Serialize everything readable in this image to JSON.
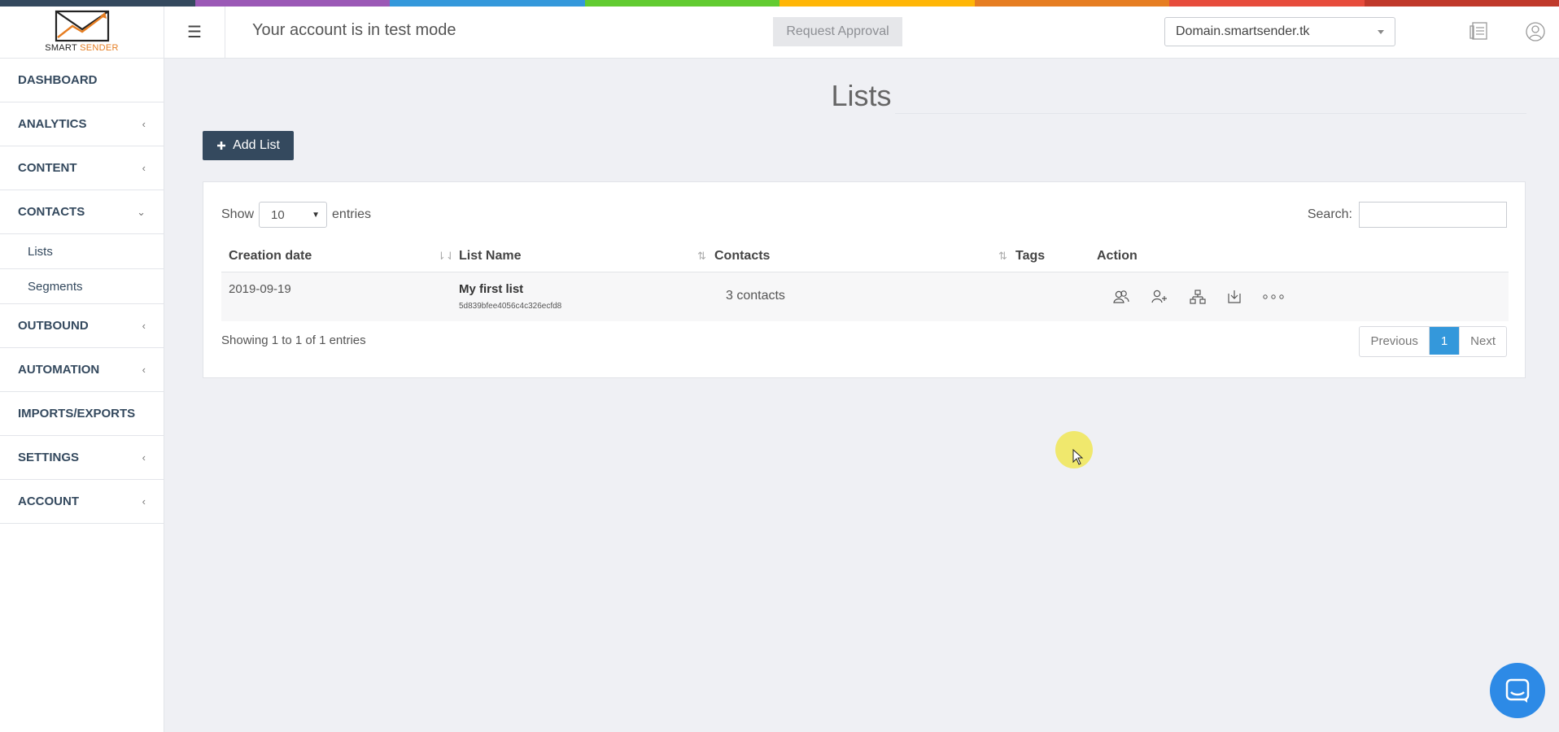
{
  "colors": {
    "accent_bar": [
      "#34495e",
      "#9b59b6",
      "#3498db",
      "#62cb31",
      "#ffb606",
      "#e67e22",
      "#e74c3c",
      "#c0392b"
    ],
    "primary_button": "#34495e",
    "active_page": "#3498db",
    "chat_button": "#2d8ae6"
  },
  "logo": {
    "brand_first": "SMART",
    "brand_second": "SENDER"
  },
  "header": {
    "menu_toggle_icon": "hamburger-icon",
    "mode_text": "Your account is in test mode",
    "request_button": "Request Approval",
    "domain_select": "Domain.smartsender.tk",
    "icons": [
      "document-icon",
      "user-icon"
    ]
  },
  "sidebar": {
    "items": [
      {
        "label": "DASHBOARD",
        "chevron": ""
      },
      {
        "label": "ANALYTICS",
        "chevron": "‹"
      },
      {
        "label": "CONTENT",
        "chevron": "‹"
      },
      {
        "label": "CONTACTS",
        "chevron": "⌄"
      },
      {
        "label": "Lists"
      },
      {
        "label": "Segments"
      },
      {
        "label": "OUTBOUND",
        "chevron": "‹"
      },
      {
        "label": "AUTOMATION",
        "chevron": "‹"
      },
      {
        "label": "IMPORTS/EXPORTS",
        "chevron": ""
      },
      {
        "label": "SETTINGS",
        "chevron": "‹"
      },
      {
        "label": "ACCOUNT",
        "chevron": "‹"
      }
    ]
  },
  "main": {
    "title": "Lists",
    "add_button": "Add List",
    "table": {
      "show_label": "Show",
      "length_value": "10",
      "entries_label": "entries",
      "search_label": "Search:",
      "search_value": "",
      "columns": [
        "Creation date",
        "List Name",
        "Contacts",
        "Tags",
        "Action"
      ],
      "rows": [
        {
          "date": "2019-09-19",
          "name": "My first list",
          "id": "5d839bfee4056c4c326ecfd8",
          "contacts": "3 contacts",
          "tags": "",
          "actions": [
            "contacts-icon",
            "add-contact-icon",
            "segments-icon",
            "export-icon",
            "more-icon"
          ]
        }
      ],
      "info": "Showing 1 to 1 of 1 entries",
      "pagination": {
        "previous": "Previous",
        "current": "1",
        "next": "Next"
      }
    }
  }
}
